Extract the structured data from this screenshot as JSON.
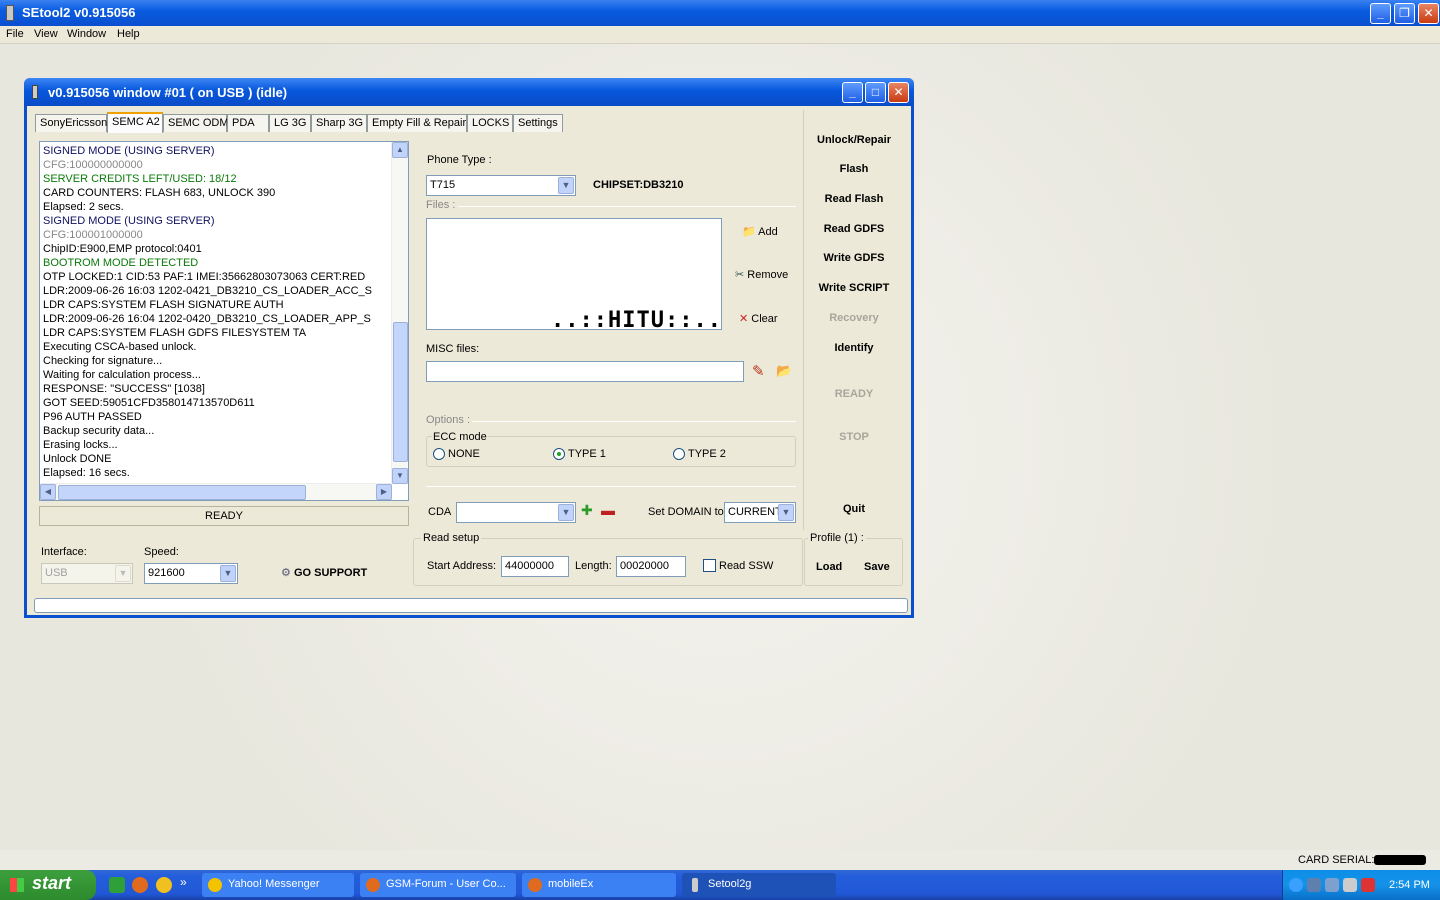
{
  "app": {
    "title": "SEtool2 v0.915056"
  },
  "menu": [
    "File",
    "View",
    "Window",
    "Help"
  ],
  "window": {
    "title": "v0.915056 window #01 ( on USB ) (idle)",
    "tabs": [
      "SonyEricsson",
      "SEMC A2",
      "SEMC ODM",
      "PDA",
      "LG 3G",
      "Sharp 3G",
      "Empty Fill & Repair",
      "LOCKS",
      "Settings"
    ],
    "active_tab": "SEMC A2"
  },
  "log": [
    "SIGNED MODE (USING SERVER)",
    "CFG:100000000000",
    "SERVER CREDITS LEFT/USED: 18/12",
    "CARD COUNTERS: FLASH 683, UNLOCK 390",
    "Elapsed: 2 secs.",
    "SIGNED MODE (USING SERVER)",
    "CFG:100001000000",
    "ChipID:E900,EMP protocol:0401",
    "BOOTROM MODE DETECTED",
    "OTP LOCKED:1 CID:53 PAF:1 IMEI:35662803073063 CERT:RED",
    "LDR:2009-06-26 16:03 1202-0421_DB3210_CS_LOADER_ACC_S",
    "LDR CAPS:SYSTEM FLASH SIGNATURE AUTH",
    "LDR:2009-06-26 16:04 1202-0420_DB3210_CS_LOADER_APP_S",
    "LDR CAPS:SYSTEM FLASH GDFS FILESYSTEM TA",
    "Executing CSCA-based unlock.",
    "Checking for signature...",
    "Waiting for calculation process...",
    "RESPONSE: \"SUCCESS\" [1038]",
    "GOT SEED:59051CFD358014713570D611",
    "P96 AUTH PASSED",
    "Backup security data...",
    "Erasing locks...",
    "Unlock DONE",
    "Elapsed: 16 secs."
  ],
  "left_status": "READY",
  "center": {
    "phone_type_label": "Phone Type :",
    "phone_type_value": "T715",
    "chipset": "CHIPSET:DB3210",
    "files_label": "Files :",
    "add": "Add",
    "remove": "Remove",
    "clear": "Clear",
    "overlay": "..::HITU::..",
    "misc_label": "MISC files:",
    "options_label": "Options :",
    "ecc_label": "ECC mode",
    "ecc_options": [
      "NONE",
      "TYPE 1",
      "TYPE 2"
    ],
    "ecc_selected": "TYPE 1",
    "cda_label": "CDA",
    "domain_label": "Set DOMAIN to",
    "domain_value": "CURRENT"
  },
  "right_buttons": {
    "unlock": "Unlock/Repair",
    "flash": "Flash",
    "read_flash": "Read Flash",
    "read_gdfs": "Read GDFS",
    "write_gdfs": "Write GDFS",
    "write_script": "Write SCRIPT",
    "recovery": "Recovery",
    "identify": "Identify",
    "ready": "READY",
    "stop": "STOP",
    "quit": "Quit"
  },
  "bottom": {
    "interface_label": "Interface:",
    "interface_value": "USB",
    "speed_label": "Speed:",
    "speed_value": "921600",
    "go_support": "GO SUPPORT",
    "read_setup_label": "Read setup",
    "start_address_label": "Start Address:",
    "start_address": "44000000",
    "length_label": "Length:",
    "length": "00020000",
    "read_ssw": "Read SSW",
    "profile_label": "Profile (1) :",
    "load": "Load",
    "save": "Save"
  },
  "card_serial_label": "CARD SERIAL:",
  "taskbar": {
    "start": "start",
    "tasks": [
      "Yahoo! Messenger",
      "GSM-Forum - User Co...",
      "mobileEx",
      "Setool2g"
    ],
    "clock": "2:54 PM"
  }
}
